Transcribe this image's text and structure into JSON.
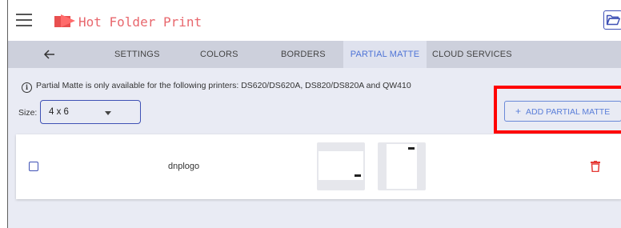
{
  "app": {
    "title": "Hot Folder Print"
  },
  "tabs": [
    {
      "label": "SETTINGS"
    },
    {
      "label": "COLORS"
    },
    {
      "label": "BORDERS"
    },
    {
      "label": "PARTIAL MATTE",
      "active": true
    },
    {
      "label": "CLOUD SERVICES"
    }
  ],
  "notice": {
    "text": "Partial Matte is only available for the following printers: DS620/DS620A, DS820/DS820A and QW410"
  },
  "size": {
    "label": "Size:",
    "value": "4 x 6"
  },
  "add_button": {
    "label": "ADD PARTIAL MATTE"
  },
  "items": [
    {
      "name": "dnplogo",
      "checked": false
    }
  ],
  "colors": {
    "accent": "#3f51b5",
    "active_tab": "#4f74d6",
    "brand": "#e8676d",
    "delete": "#e53935",
    "highlight": "#ff0000"
  },
  "icons": [
    "menu-icon",
    "app-logo-icon",
    "folder-open-icon",
    "back-arrow-icon",
    "info-icon",
    "chevron-down-icon",
    "plus-icon",
    "trash-icon"
  ]
}
